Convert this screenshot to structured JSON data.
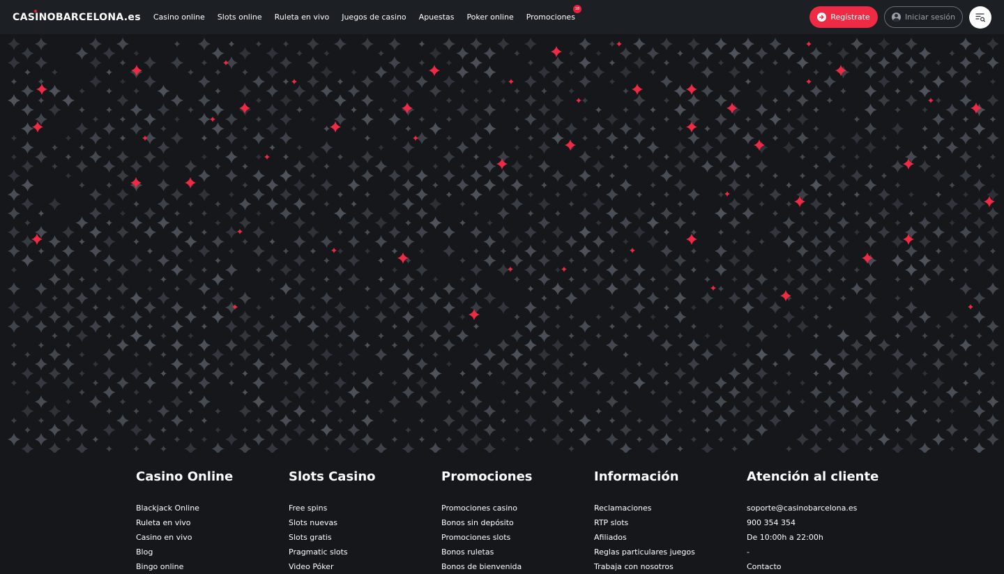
{
  "header": {
    "logo": "CASINOBARCELONA.es",
    "nav": [
      {
        "label": "Casino online",
        "name": "nav-casino-online"
      },
      {
        "label": "Slots online",
        "name": "nav-slots-online"
      },
      {
        "label": "Ruleta en vivo",
        "name": "nav-ruleta-en-vivo"
      },
      {
        "label": "Juegos de casino",
        "name": "nav-juegos-de-casino"
      },
      {
        "label": "Apuestas",
        "name": "nav-apuestas"
      },
      {
        "label": "Poker online",
        "name": "nav-poker-online"
      },
      {
        "label": "Promociones",
        "name": "nav-promociones",
        "badge": "18"
      }
    ],
    "register_label": "Regístrate",
    "login_label": "Iniciar sesión",
    "icons": {
      "register": "arrow-right-circle-icon",
      "login": "user-circle-icon",
      "menu": "menu-search-icon"
    },
    "colors": {
      "accent": "#ee2a44",
      "header_bg": "#1c1f24",
      "page_bg": "#15171b"
    }
  },
  "footer": {
    "columns": [
      {
        "title": "Casino Online",
        "links": [
          "Blackjack Online",
          "Ruleta en vivo",
          "Casino en vivo",
          "Blog",
          "Bingo online"
        ]
      },
      {
        "title": "Slots Casino",
        "links": [
          "Free spins",
          "Slots nuevas",
          "Slots gratis",
          "Pragmatic slots",
          "Video Póker"
        ]
      },
      {
        "title": "Promociones",
        "links": [
          "Promociones casino",
          "Bonos sin depósito",
          "Promociones slots",
          "Bonos ruletas",
          "Bonos de bienvenida"
        ]
      },
      {
        "title": "Información",
        "links": [
          "Reclamaciones",
          "RTP slots",
          "Afiliados",
          "Reglas particulares juegos",
          "Trabaja con nosotros"
        ]
      },
      {
        "title": "Atención al cliente",
        "links": [
          "soporte@casinobarcelona.es",
          "900 354 354",
          "De 10:00h a 22:00h",
          "-",
          "Contacto"
        ]
      }
    ]
  }
}
